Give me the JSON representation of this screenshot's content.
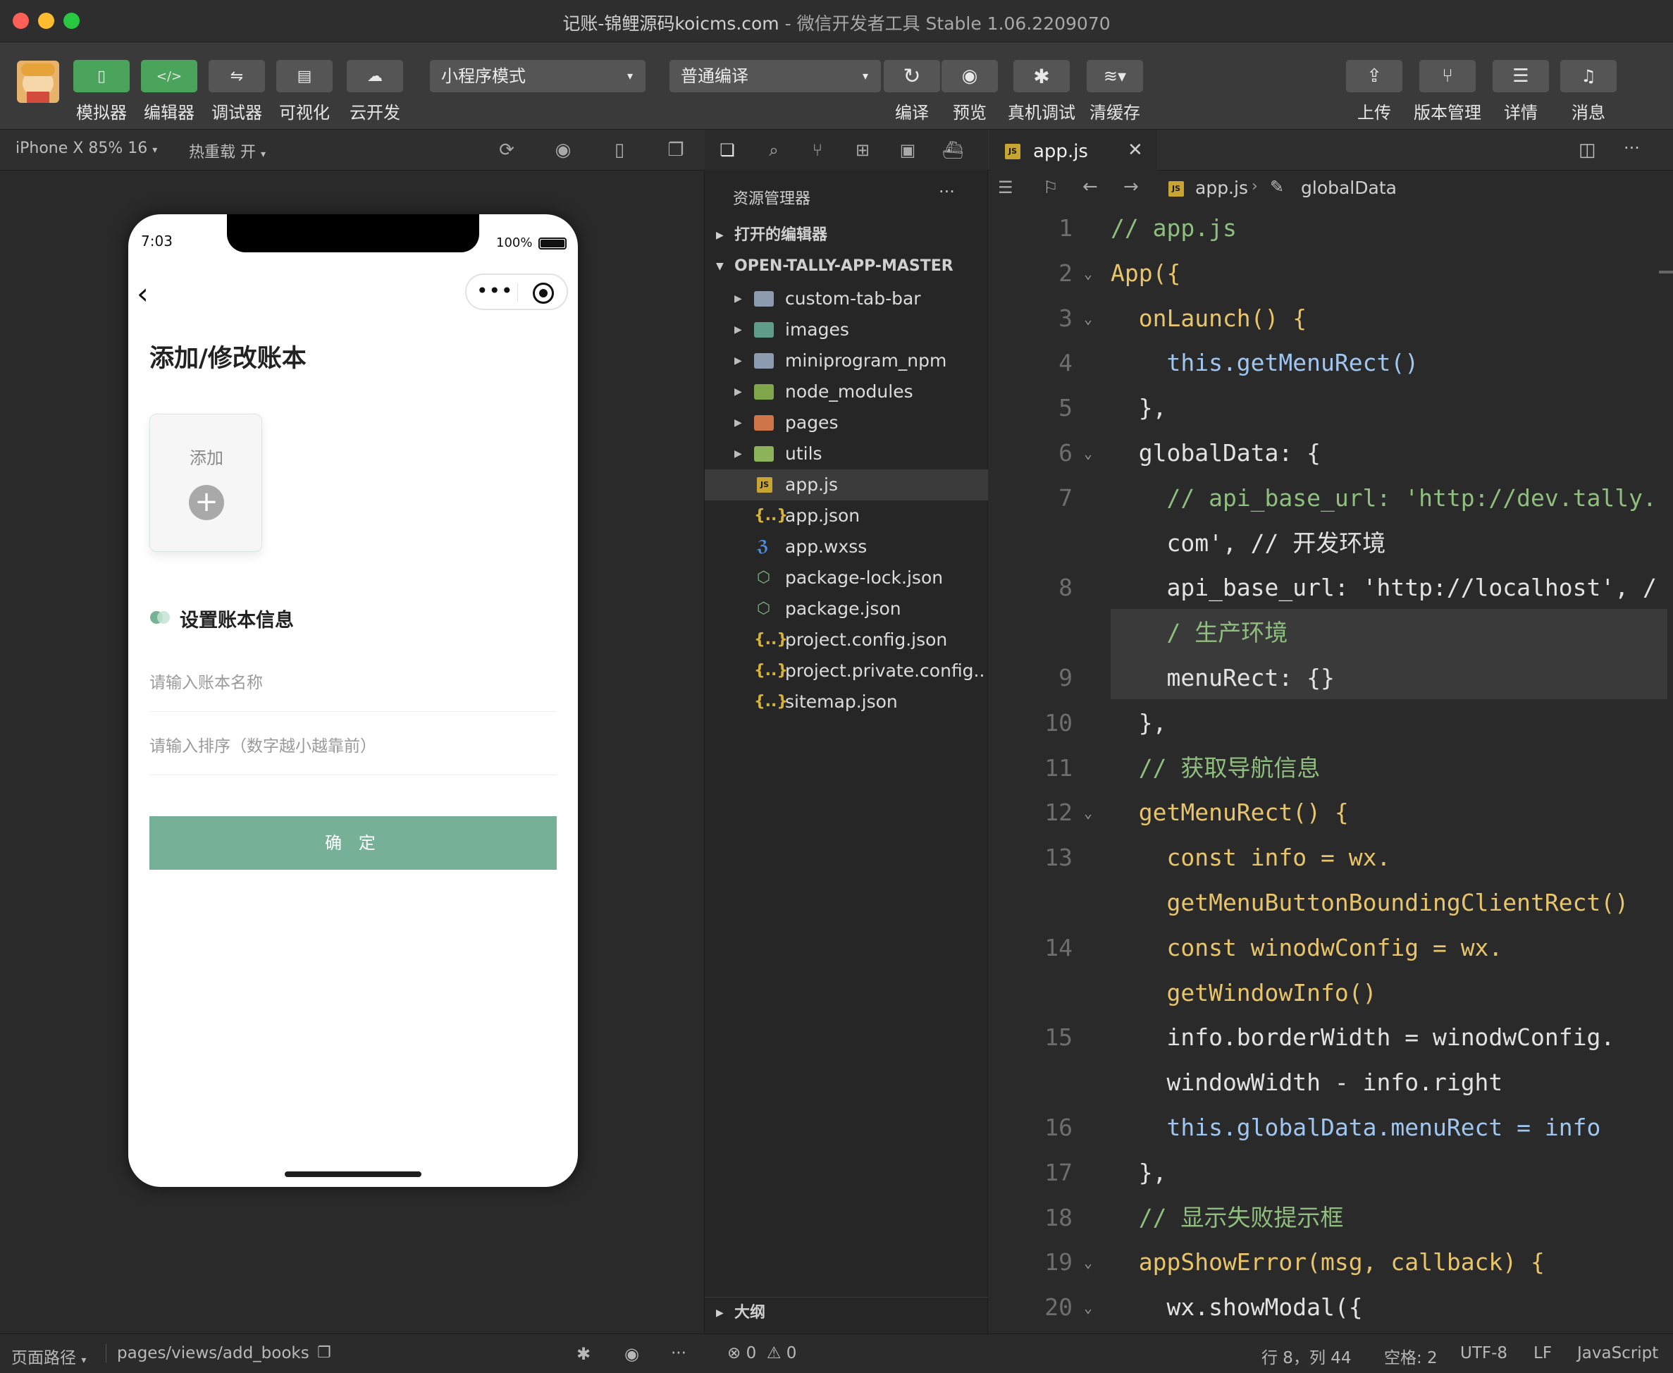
{
  "window": {
    "title": "记账-锦鲤源码koicms.com",
    "app_name": "微信开发者工具 Stable 1.06.2209070"
  },
  "toolbar": {
    "left_buttons": [
      {
        "icon": "phone-icon",
        "label": "模拟器"
      },
      {
        "icon": "code-icon",
        "label": "编辑器"
      },
      {
        "icon": "debug-icon",
        "label": "调试器"
      },
      {
        "icon": "layout-icon",
        "label": "可视化"
      },
      {
        "icon": "cloud-icon",
        "label": "云开发"
      }
    ],
    "mode_select": "小程序模式",
    "compile_select": "普通编译",
    "mid_buttons": [
      {
        "icon": "refresh-icon",
        "label": "编译"
      },
      {
        "icon": "eye-icon",
        "label": "预览"
      },
      {
        "icon": "bug-icon",
        "label": "真机调试"
      },
      {
        "icon": "layers-icon",
        "label": "清缓存"
      }
    ],
    "right_buttons": [
      {
        "icon": "upload-icon",
        "label": "上传"
      },
      {
        "icon": "branch-icon",
        "label": "版本管理"
      },
      {
        "icon": "menu-icon",
        "label": "详情"
      },
      {
        "icon": "bell-icon",
        "label": "消息"
      }
    ]
  },
  "simulator": {
    "device": "iPhone X 85% 16",
    "hot_reload": "热重载 开",
    "phone": {
      "time": "7:03",
      "battery": "100%",
      "page_title": "添加/修改账本",
      "add_label": "添加",
      "section_title": "设置账本信息",
      "name_placeholder": "请输入账本名称",
      "order_placeholder": "请输入排序（数字越小越靠前）",
      "confirm_label": "确 定"
    }
  },
  "explorer": {
    "title": "资源管理器",
    "open_editors": "打开的编辑器",
    "project": "OPEN-TALLY-APP-MASTER",
    "outline": "大纲",
    "files": [
      {
        "name": "custom-tab-bar",
        "type": "folder"
      },
      {
        "name": "images",
        "type": "folder"
      },
      {
        "name": "miniprogram_npm",
        "type": "folder"
      },
      {
        "name": "node_modules",
        "type": "folder"
      },
      {
        "name": "pages",
        "type": "folder"
      },
      {
        "name": "utils",
        "type": "folder"
      },
      {
        "name": "app.js",
        "type": "js"
      },
      {
        "name": "app.json",
        "type": "json"
      },
      {
        "name": "app.wxss",
        "type": "css"
      },
      {
        "name": "package-lock.json",
        "type": "npm"
      },
      {
        "name": "package.json",
        "type": "npm"
      },
      {
        "name": "project.config.json",
        "type": "json"
      },
      {
        "name": "project.private.config...",
        "type": "json"
      },
      {
        "name": "sitemap.json",
        "type": "json"
      }
    ]
  },
  "editor": {
    "tab": "app.js",
    "breadcrumb_file": "app.js",
    "breadcrumb_symbol": "globalData",
    "lines": [
      {
        "n": "1",
        "text": "// app.js"
      },
      {
        "n": "2",
        "text": "App({"
      },
      {
        "n": "3",
        "text": "  onLaunch() {"
      },
      {
        "n": "4",
        "text": "    this.getMenuRect()"
      },
      {
        "n": "5",
        "text": "  },"
      },
      {
        "n": "6",
        "text": "  globalData: {"
      },
      {
        "n": "7",
        "text": "    // api_base_url: 'http://dev.tally."
      },
      {
        "n": "",
        "text": "    com', // 开发环境"
      },
      {
        "n": "8",
        "text": "    api_base_url: 'http://localhost', /"
      },
      {
        "n": "",
        "text": "    / 生产环境"
      },
      {
        "n": "9",
        "text": "    menuRect: {}"
      },
      {
        "n": "10",
        "text": "  },"
      },
      {
        "n": "11",
        "text": "  // 获取导航信息"
      },
      {
        "n": "12",
        "text": "  getMenuRect() {"
      },
      {
        "n": "13",
        "text": "    const info = wx."
      },
      {
        "n": "",
        "text": "    getMenuButtonBoundingClientRect()"
      },
      {
        "n": "14",
        "text": "    const winodwConfig = wx."
      },
      {
        "n": "",
        "text": "    getWindowInfo()"
      },
      {
        "n": "15",
        "text": "    info.borderWidth = winodwConfig."
      },
      {
        "n": "",
        "text": "    windowWidth - info.right"
      },
      {
        "n": "16",
        "text": "    this.globalData.menuRect = info"
      },
      {
        "n": "17",
        "text": "  },"
      },
      {
        "n": "18",
        "text": "  // 显示失败提示框"
      },
      {
        "n": "19",
        "text": "  appShowError(msg, callback) {"
      },
      {
        "n": "20",
        "text": "    wx.showModal({"
      }
    ]
  },
  "statusbar": {
    "page_path_label": "页面路径",
    "page_path": "pages/views/add_books",
    "errors": "0",
    "warnings": "0",
    "cursor": "行 8，列 44",
    "indent": "空格: 2",
    "encoding": "UTF-8",
    "eol": "LF",
    "language": "JavaScript"
  },
  "colors": {
    "accent_green": "#4aa45b",
    "phone_button": "#76b096"
  }
}
